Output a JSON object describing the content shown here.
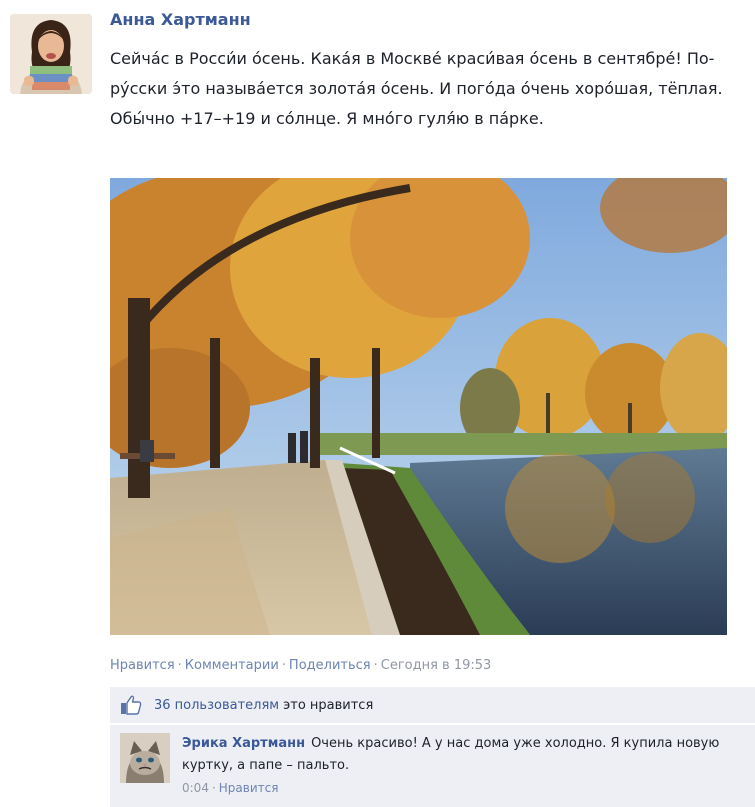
{
  "post": {
    "author": "Анна Хартманн",
    "avatar_icon": "author-avatar",
    "message": "Сейча́с в Росси́и о́сень. Кака́я в Москве́ краси́вая о́сень в сентябре́! По-ру́сски э́то называ́ется золота́я о́сень. И пого́да о́чень хоро́шая, тёплая. Обы́чно +17–+19 и со́лнце. Я мно́го гуля́ю в па́рке.",
    "photo_icon": "autumn-park-photo"
  },
  "actions": {
    "like": "Нравится",
    "comment": "Комментарии",
    "share": "Поделиться",
    "separator": "·",
    "timestamp": "Сегодня в 19:53"
  },
  "likes": {
    "icon": "thumbs-up-icon",
    "count": "36 пользователям",
    "text": "это нравится"
  },
  "comment": {
    "author": "Эрика Хартманн",
    "avatar_icon": "cat-avatar",
    "text": "Очень красиво! А у нас дома уже холодно. Я купила новую куртку, а папе – пальто.",
    "time": "0:04",
    "separator": "·",
    "like": "Нравится"
  },
  "colors": {
    "link": "#3b5998",
    "action_link": "#6d84b4",
    "muted": "#9197a3",
    "panel_bg": "#edeff4"
  }
}
